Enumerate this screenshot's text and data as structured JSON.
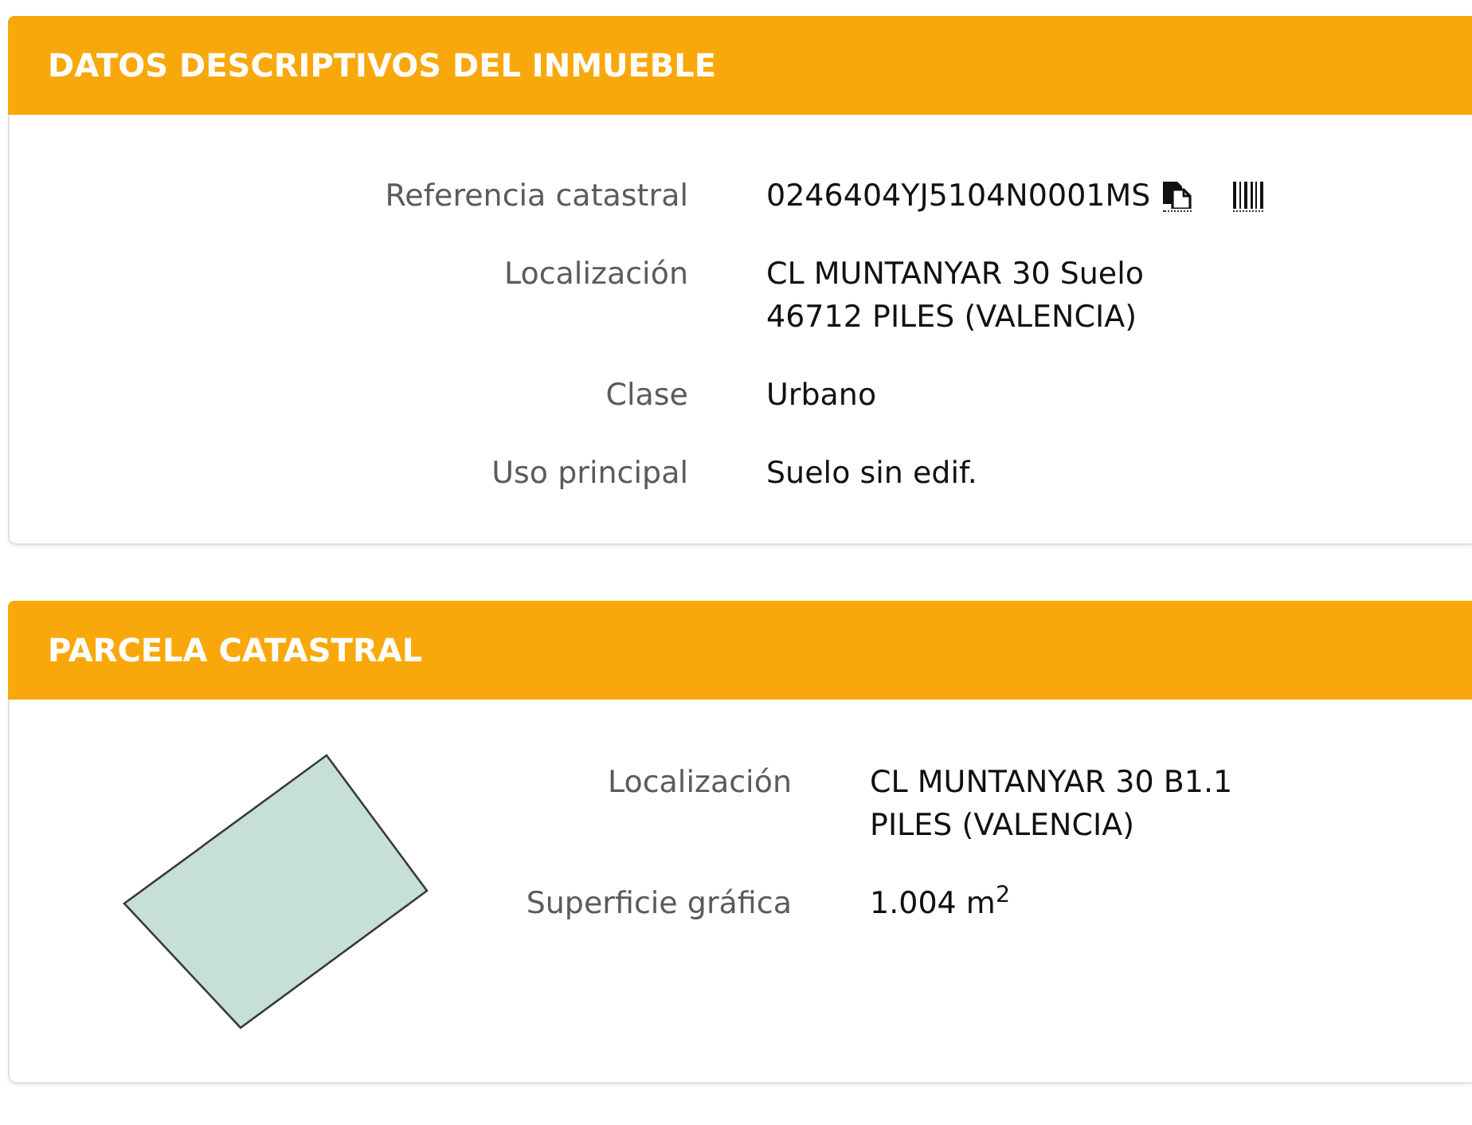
{
  "sections": [
    {
      "kind": "details",
      "title": "DATOS DESCRIPTIVOS DEL INMUEBLE",
      "fields": [
        {
          "label": "Referencia catastral",
          "value": [
            "0246404YJ5104N0001MS"
          ],
          "actions": [
            {
              "kind": "copy"
            },
            {
              "kind": "barcode"
            }
          ]
        },
        {
          "label": "Localización",
          "value": [
            "CL MUNTANYAR 30 Suelo",
            "46712 PILES (VALENCIA)"
          ]
        },
        {
          "label": "Clase",
          "value": [
            "Urbano"
          ]
        },
        {
          "label": "Uso principal",
          "value": [
            "Suelo sin edif."
          ]
        }
      ]
    },
    {
      "kind": "parcel",
      "title": "PARCELA CATASTRAL",
      "fields": [
        {
          "label": "Localización",
          "value": [
            "CL MUNTANYAR 30 B1.1",
            "PILES (VALENCIA)"
          ]
        },
        {
          "label": "Superficie gráfica",
          "value": [
            "1.004 m$^{2}$"
          ]
        }
      ]
    }
  ]
}
